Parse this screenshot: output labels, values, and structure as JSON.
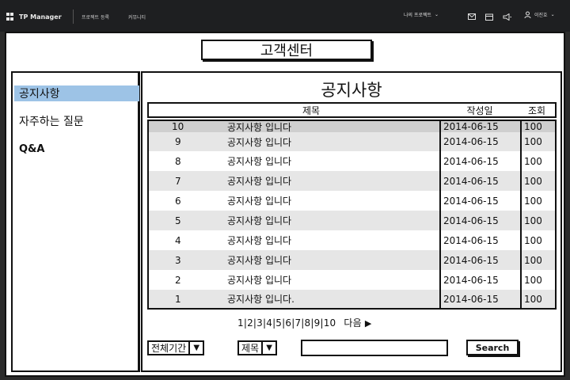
{
  "topbar": {
    "app_name": "TP Manager",
    "nav": [
      "프로젝트 등록",
      "커뮤니티"
    ],
    "my_projects": "나의 프로젝트",
    "user_name": "이진호",
    "icons": [
      "mail-icon",
      "calendar-icon",
      "megaphone-icon",
      "user-icon"
    ]
  },
  "page": {
    "title": "고객센터"
  },
  "sidebar": {
    "items": [
      {
        "label": "공지사항",
        "active": true
      },
      {
        "label": "자주하는 질문",
        "active": false
      },
      {
        "label": "Q&A",
        "active": false
      }
    ]
  },
  "content": {
    "title": "공지사항"
  },
  "table": {
    "headers": {
      "title": "제목",
      "date": "작성일",
      "views": "조회"
    },
    "rows": [
      {
        "no": "10",
        "title": "공지사항 입니다",
        "date": "2014-06-15",
        "views": "100"
      },
      {
        "no": "9",
        "title": "공지사항 입니다",
        "date": "2014-06-15",
        "views": "100"
      },
      {
        "no": "8",
        "title": "공지사항 입니다",
        "date": "2014-06-15",
        "views": "100"
      },
      {
        "no": "7",
        "title": "공지사항 입니다",
        "date": "2014-06-15",
        "views": "100"
      },
      {
        "no": "6",
        "title": "공지사항 입니다",
        "date": "2014-06-15",
        "views": "100"
      },
      {
        "no": "5",
        "title": "공지사항 입니다",
        "date": "2014-06-15",
        "views": "100"
      },
      {
        "no": "4",
        "title": "공지사항 입니다",
        "date": "2014-06-15",
        "views": "100"
      },
      {
        "no": "3",
        "title": "공지사항 입니다",
        "date": "2014-06-15",
        "views": "100"
      },
      {
        "no": "2",
        "title": "공지사항 입니다",
        "date": "2014-06-15",
        "views": "100"
      },
      {
        "no": "1",
        "title": "공지사항 입니다.",
        "date": "2014-06-15",
        "views": "100"
      }
    ]
  },
  "pagination": {
    "pages": "1|2|3|4|5|6|7|8|9|10",
    "next": "다음"
  },
  "filters": {
    "period": "전체기간",
    "field": "제목",
    "search_value": "",
    "search_button": "Search"
  },
  "colors": {
    "topbar": "#1e1f21",
    "active_menu": "#9dc3e6",
    "row_shade": "#e6e6e6"
  }
}
